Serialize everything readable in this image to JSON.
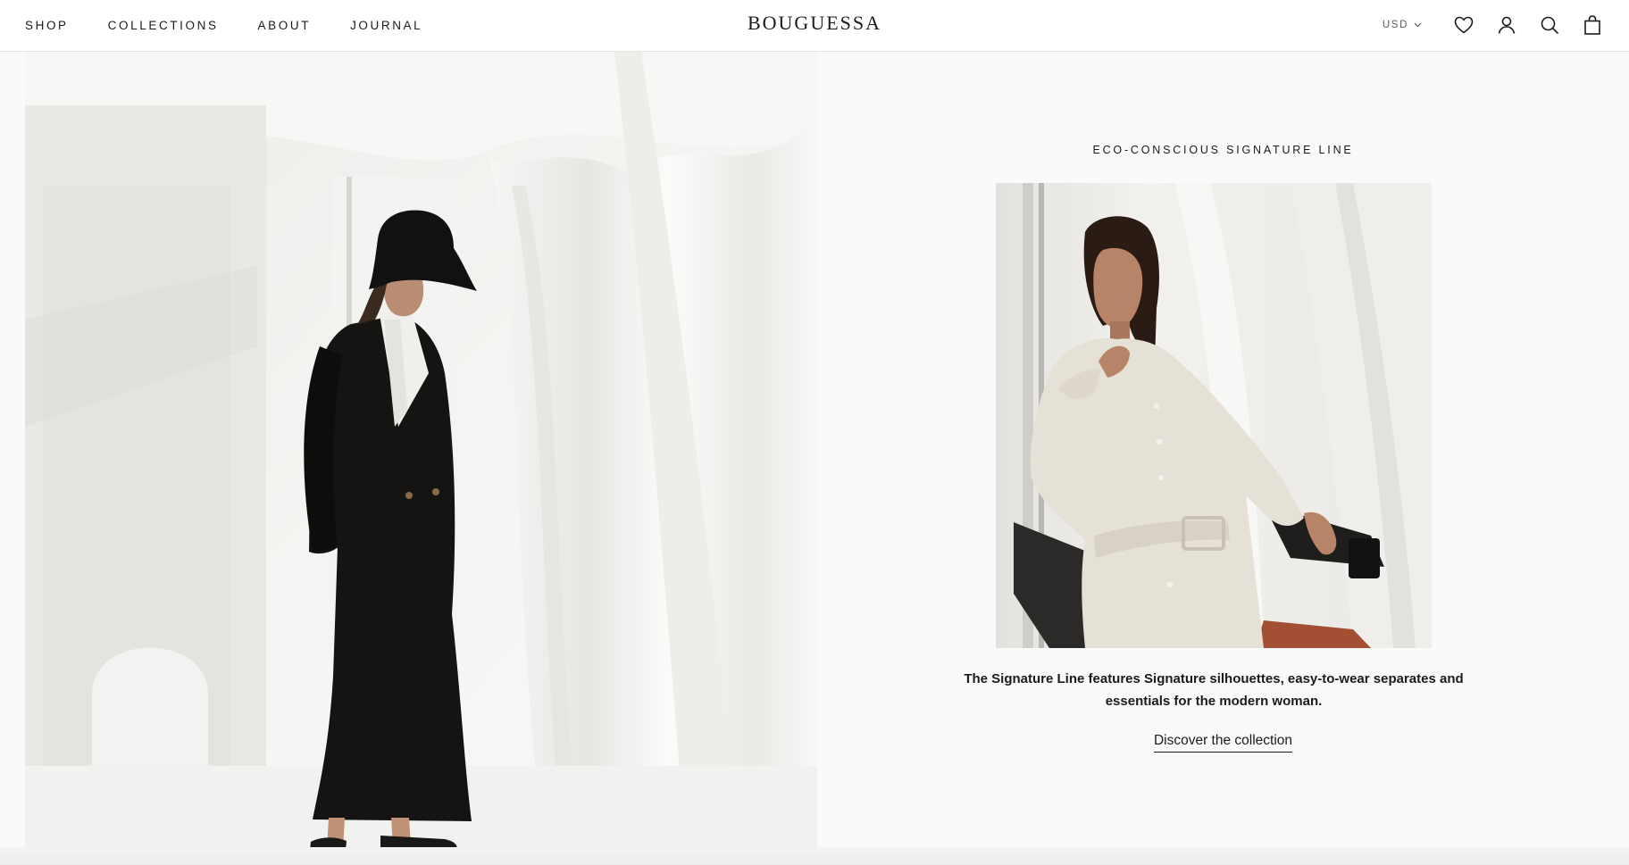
{
  "header": {
    "nav": [
      "SHOP",
      "COLLECTIONS",
      "ABOUT",
      "JOURNAL"
    ],
    "logo": "BOUGUESSA",
    "currency": "USD",
    "icons": [
      "wishlist-heart-icon",
      "account-user-icon",
      "search-icon",
      "cart-bag-icon"
    ]
  },
  "section": {
    "eyebrow": "ECO-CONSCIOUS SIGNATURE LINE",
    "description": "The Signature Line features Signature silhouettes, easy-to-wear separates and essentials for the modern woman.",
    "cta": "Discover the collection"
  },
  "colors": {
    "text": "#1c1b1b",
    "background": "#fafafa",
    "header_bg": "#ffffff"
  }
}
